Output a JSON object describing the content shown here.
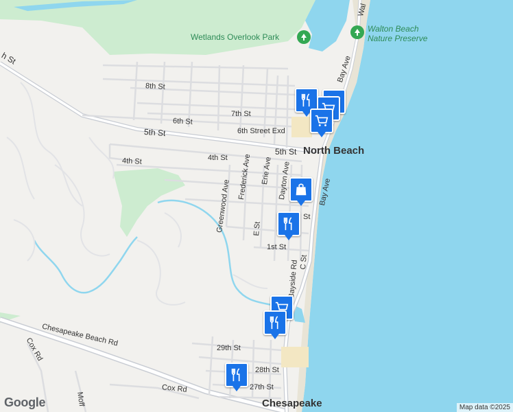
{
  "map": {
    "place_labels": {
      "north_beach": "North Beach",
      "chesapeake": "Chesapeake"
    },
    "parks": {
      "wetlands": "Wetlands Overlook Park",
      "walton_line1": "Walton Beach",
      "walton_line2": "Nature Preserve"
    },
    "streets": {
      "s8th": "8th St",
      "s7th": "7th St",
      "s6th": "6th St",
      "s6th_exd": "6th Street Exd",
      "s5th_west": "5th St",
      "s5th_east": "5th St",
      "s4th_west": "4th St",
      "s4th_east": "4th St",
      "s1st": "1st St",
      "st_partial": "St",
      "h_st": "h St",
      "greenwood": "Greenwood Ave",
      "frederick": "Frederick Ave",
      "erie": "Erie Ave",
      "dayton": "Dayton Ave",
      "e_st": "E St",
      "c_st": "C St",
      "bayside": "Bayside Rd",
      "bay_ave_north": "Bay Ave",
      "bay_ave_south": "Bay Ave",
      "wal": "Wal",
      "chesapeake_beach_rd": "Chesapeake Beach Rd",
      "cox_rd": "Cox Rd",
      "cox_rd_2": "Cox Rd",
      "s29th": "29th St",
      "s28th": "28th St",
      "s27th": "27th St",
      "moff": "Moff"
    },
    "markers": [
      {
        "type": "restaurant",
        "icon": "fork-knife-icon"
      },
      {
        "type": "shopping",
        "icon": "shopping-cart-icon"
      },
      {
        "type": "shopping",
        "icon": "shopping-cart-icon"
      },
      {
        "type": "store",
        "icon": "shopping-bag-icon"
      },
      {
        "type": "restaurant",
        "icon": "fork-knife-icon"
      },
      {
        "type": "shopping",
        "icon": "shopping-cart-icon"
      },
      {
        "type": "restaurant",
        "icon": "fork-knife-icon"
      },
      {
        "type": "restaurant",
        "icon": "fork-knife-icon"
      },
      {
        "type": "restaurant",
        "icon": "fork-knife-icon"
      }
    ],
    "colors": {
      "water": "#8fd6ee",
      "land": "#f2f1ee",
      "park": "#cdecd0",
      "road": "#ffffff",
      "major_road": "#c8ccd3",
      "marker": "#1a73e8"
    }
  },
  "branding": {
    "logo": "Google",
    "attribution": "Map data ©2025"
  }
}
